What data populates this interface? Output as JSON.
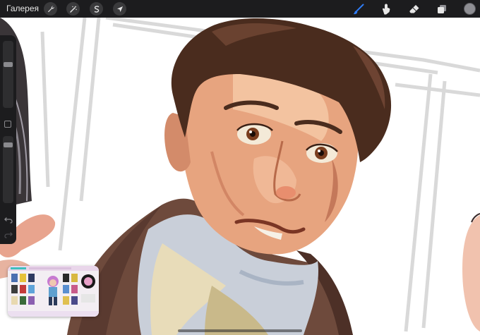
{
  "toolbar": {
    "gallery_label": "Галерея",
    "left_tools": [
      {
        "name": "actions",
        "icon": "wrench-icon"
      },
      {
        "name": "adjustments",
        "icon": "magic-wand-icon"
      },
      {
        "name": "selection",
        "icon": "selection-s-icon"
      },
      {
        "name": "transform",
        "icon": "arrow-cursor-icon"
      }
    ],
    "right_tools": [
      {
        "name": "brush",
        "icon": "brush-icon",
        "active": true
      },
      {
        "name": "smudge",
        "icon": "smudge-finger-icon",
        "active": false
      },
      {
        "name": "eraser",
        "icon": "eraser-icon",
        "active": false
      },
      {
        "name": "layers",
        "icon": "layers-icon",
        "active": false
      }
    ],
    "active_color": "#8e8e93",
    "accent_color": "#2f7cf6"
  },
  "sidebar": {
    "brush_size_level": 0.15,
    "opacity_level": 0.12,
    "modify_icon": "square-outline-icon",
    "undo_icon": "undo-arrow-icon",
    "redo_icon": "redo-arrow-icon"
  },
  "pip": {
    "content": "video-thumbnail"
  }
}
